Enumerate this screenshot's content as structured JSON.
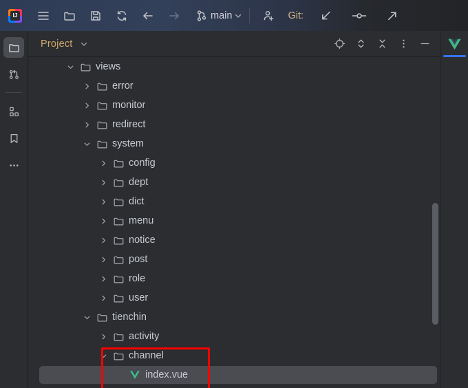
{
  "toolbar": {
    "logo_text": "IJ",
    "items": [
      {
        "name": "main-menu-icon",
        "label": "Main Menu"
      },
      {
        "name": "open-folder-icon",
        "label": "Open"
      },
      {
        "name": "save-icon",
        "label": "Save All"
      },
      {
        "name": "sync-icon",
        "label": "Reload All from Disk"
      },
      {
        "name": "back-arrow-icon",
        "label": "Back"
      },
      {
        "name": "forward-arrow-icon",
        "label": "Forward"
      }
    ],
    "branch_icon": "branch-icon",
    "branch_name": "main",
    "branch_chevron": "chevron-down-icon",
    "add_user_icon": "add-user-icon",
    "git_label": "Git:",
    "git_update_icon": "git-update-icon",
    "git_commit_icon": "git-commit-icon",
    "git_push_icon": "git-push-icon"
  },
  "activity_bar": {
    "items": [
      {
        "name": "sidebar-item-project",
        "icon": "folder-icon",
        "label": "Project",
        "selected": true
      },
      {
        "name": "sidebar-item-pull-requests",
        "icon": "pull-request-icon",
        "label": "Pull Requests",
        "selected": false
      },
      {
        "name": "sidebar-item-structure",
        "icon": "structure-icon",
        "label": "Structure",
        "selected": false
      },
      {
        "name": "sidebar-item-bookmarks",
        "icon": "bookmark-icon",
        "label": "Bookmarks",
        "selected": false
      },
      {
        "name": "sidebar-item-more",
        "icon": "more-dots-icon",
        "label": "More Tool Windows",
        "selected": false
      }
    ]
  },
  "panel_header": {
    "title": "Project",
    "title_chevron": "chevron-down-icon",
    "buttons": [
      {
        "name": "locate-button",
        "icon": "crosshair-icon",
        "label": "Select Opened File"
      },
      {
        "name": "expand-all-button",
        "icon": "expand-chevrons-icon",
        "label": "Expand All"
      },
      {
        "name": "collapse-all-button",
        "icon": "collapse-chevrons-icon",
        "label": "Collapse All"
      },
      {
        "name": "options-button",
        "icon": "vertical-dots-icon",
        "label": "Options"
      },
      {
        "name": "hide-button",
        "icon": "minus-icon",
        "label": "Hide"
      }
    ]
  },
  "right_bar": {
    "vue_tab": {
      "name": "tab-vue",
      "icon": "vue-logo-icon",
      "label": "Vue",
      "active": true
    }
  },
  "tree": {
    "rows": [
      {
        "name": "tree-node-views",
        "label": "views",
        "icon": "folder-icon",
        "depth": 1,
        "state": "expanded",
        "selected": false
      },
      {
        "name": "tree-node-error",
        "label": "error",
        "icon": "folder-icon",
        "depth": 2,
        "state": "collapsed",
        "selected": false
      },
      {
        "name": "tree-node-monitor",
        "label": "monitor",
        "icon": "folder-icon",
        "depth": 2,
        "state": "collapsed",
        "selected": false
      },
      {
        "name": "tree-node-redirect",
        "label": "redirect",
        "icon": "folder-icon",
        "depth": 2,
        "state": "collapsed",
        "selected": false
      },
      {
        "name": "tree-node-system",
        "label": "system",
        "icon": "folder-icon",
        "depth": 2,
        "state": "expanded",
        "selected": false
      },
      {
        "name": "tree-node-config",
        "label": "config",
        "icon": "folder-icon",
        "depth": 3,
        "state": "collapsed",
        "selected": false
      },
      {
        "name": "tree-node-dept",
        "label": "dept",
        "icon": "folder-icon",
        "depth": 3,
        "state": "collapsed",
        "selected": false
      },
      {
        "name": "tree-node-dict",
        "label": "dict",
        "icon": "folder-icon",
        "depth": 3,
        "state": "collapsed",
        "selected": false
      },
      {
        "name": "tree-node-menu",
        "label": "menu",
        "icon": "folder-icon",
        "depth": 3,
        "state": "collapsed",
        "selected": false
      },
      {
        "name": "tree-node-notice",
        "label": "notice",
        "icon": "folder-icon",
        "depth": 3,
        "state": "collapsed",
        "selected": false
      },
      {
        "name": "tree-node-post",
        "label": "post",
        "icon": "folder-icon",
        "depth": 3,
        "state": "collapsed",
        "selected": false
      },
      {
        "name": "tree-node-role",
        "label": "role",
        "icon": "folder-icon",
        "depth": 3,
        "state": "collapsed",
        "selected": false
      },
      {
        "name": "tree-node-user",
        "label": "user",
        "icon": "folder-icon",
        "depth": 3,
        "state": "collapsed",
        "selected": false
      },
      {
        "name": "tree-node-tienchin",
        "label": "tienchin",
        "icon": "folder-icon",
        "depth": 2,
        "state": "expanded",
        "selected": false
      },
      {
        "name": "tree-node-activity",
        "label": "activity",
        "icon": "folder-icon",
        "depth": 3,
        "state": "collapsed",
        "selected": false
      },
      {
        "name": "tree-node-channel",
        "label": "channel",
        "icon": "folder-icon",
        "depth": 3,
        "state": "expanded",
        "selected": false
      },
      {
        "name": "tree-node-index-vue",
        "label": "index.vue",
        "icon": "vue-logo-icon",
        "depth": 4,
        "state": "leaf",
        "selected": true
      }
    ]
  },
  "annotation": {
    "name": "highlight-box-channel-index-vue",
    "color": "#fe0000"
  },
  "colors": {
    "panel_bg": "#2b2d30",
    "window_bg": "#1e1f22",
    "selection_bg": "#4a4c51",
    "accent_blue": "#3574f0",
    "title_orange": "#cfa86b",
    "vue_green": "#41b883",
    "annotation_red": "#fe0000"
  }
}
